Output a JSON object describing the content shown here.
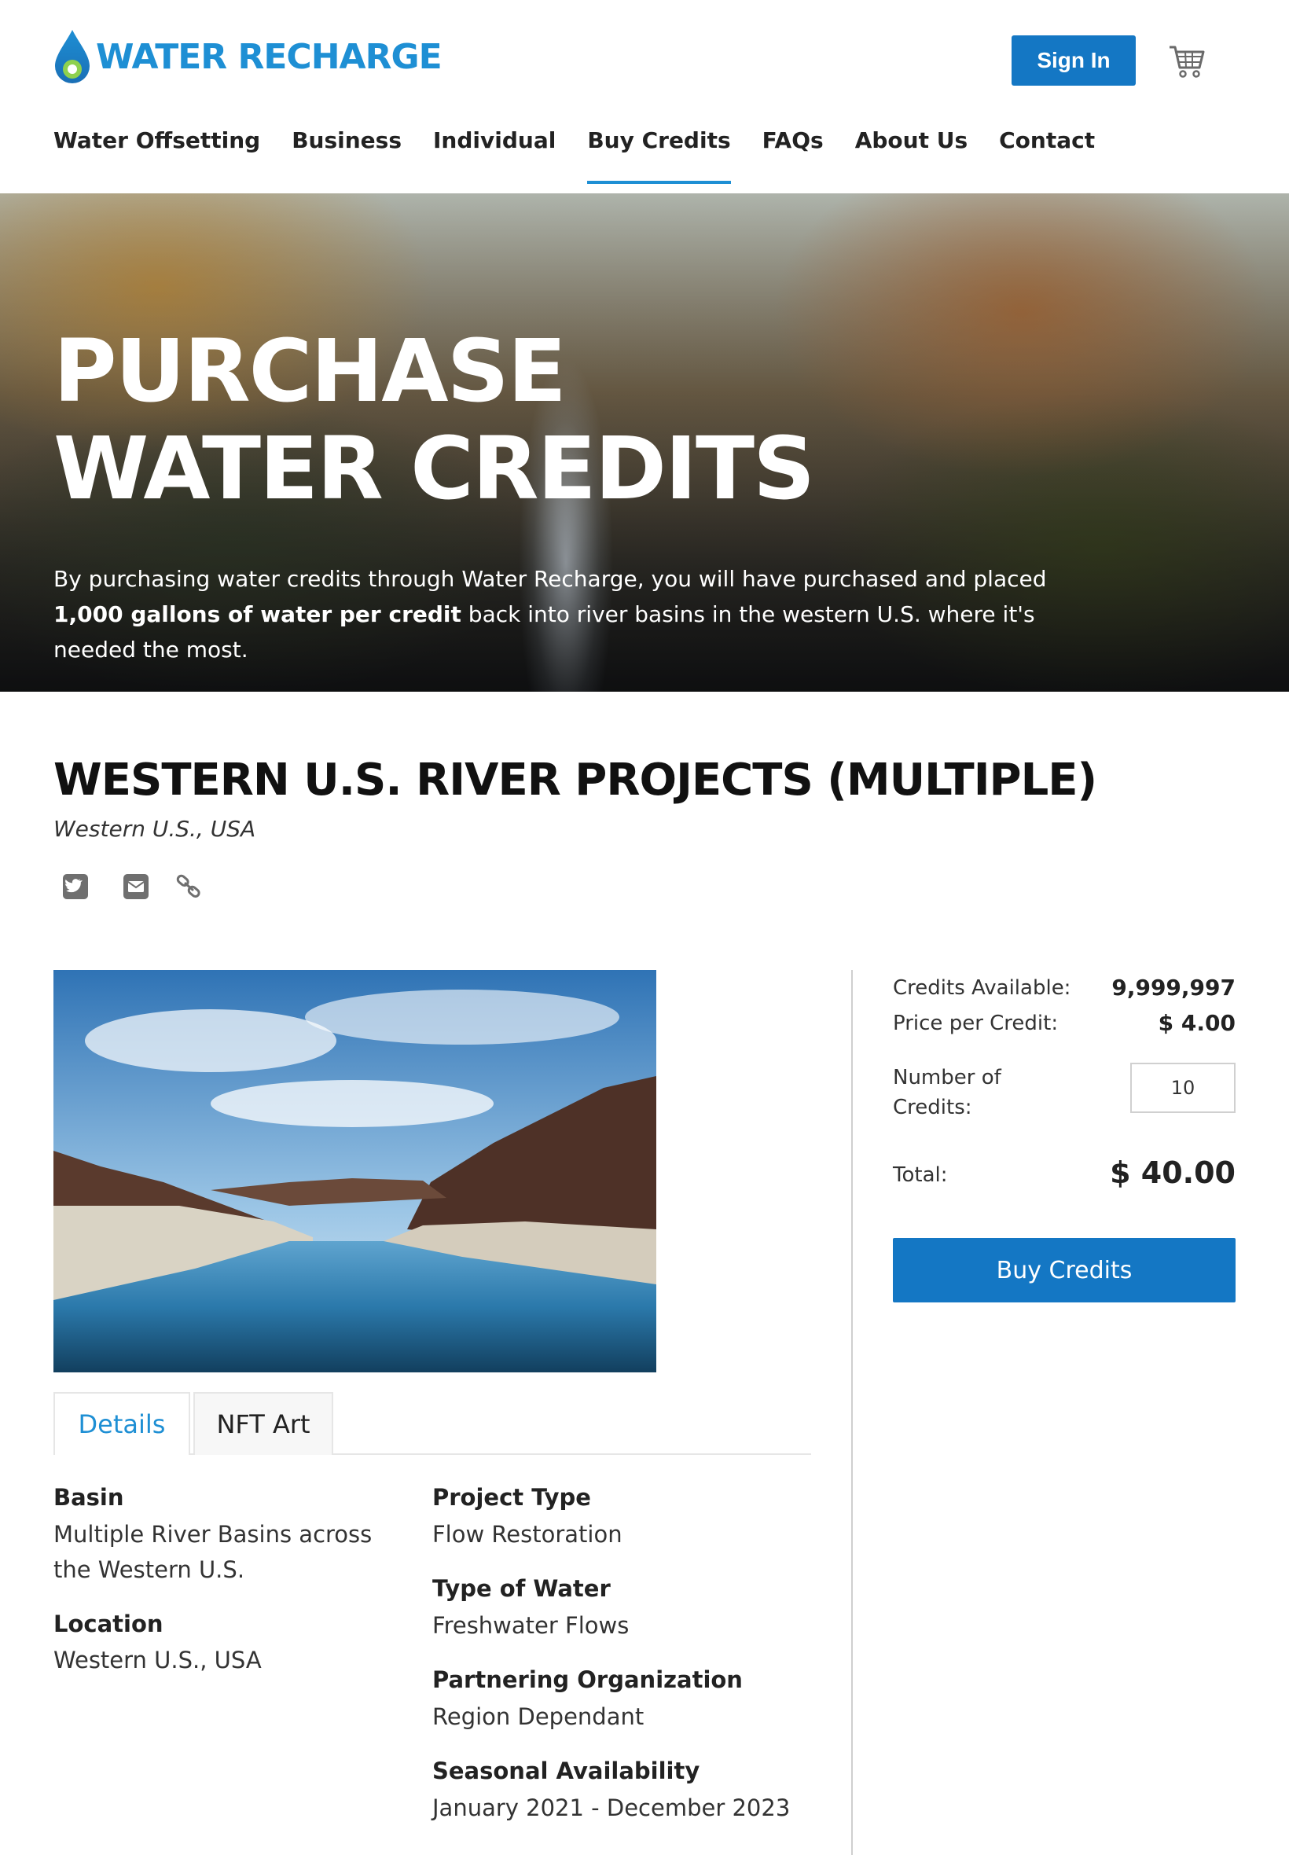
{
  "brand": {
    "name": "WATER RECHARGE"
  },
  "header": {
    "sign_in_label": "Sign In",
    "cart_icon": "cart-icon"
  },
  "nav": {
    "items": [
      {
        "label": "Water Offsetting"
      },
      {
        "label": "Business"
      },
      {
        "label": "Individual"
      },
      {
        "label": "Buy Credits",
        "active": true
      },
      {
        "label": "FAQs"
      },
      {
        "label": "About Us"
      },
      {
        "label": "Contact"
      }
    ]
  },
  "hero": {
    "title": "PURCHASE WATER CREDITS",
    "text_before": "By purchasing water credits through Water Recharge, you will have purchased and placed ",
    "text_bold": "1,000 gallons of water per credit",
    "text_after": " back into river basins in the western U.S. where it's needed the most."
  },
  "project": {
    "title": "WESTERN U.S. RIVER PROJECTS (MULTIPLE)",
    "subtitle": "Western U.S., USA",
    "share_icons": [
      "twitter-icon",
      "email-icon",
      "link-icon"
    ]
  },
  "tabs": [
    {
      "label": "Details",
      "active": true
    },
    {
      "label": "NFT Art",
      "active": false
    }
  ],
  "details": {
    "basin_label": "Basin",
    "basin_value": "Multiple River Basins across the Western U.S.",
    "location_label": "Location",
    "location_value": "Western U.S., USA",
    "project_type_label": "Project Type",
    "project_type_value": "Flow Restoration",
    "water_type_label": "Type of Water",
    "water_type_value": "Freshwater Flows",
    "partner_label": "Partnering Organization",
    "partner_value": "Region Dependant",
    "season_label": "Seasonal Availability",
    "season_value": "January 2021 - December 2023"
  },
  "purchase": {
    "credits_available_label": "Credits Available:",
    "credits_available_value": "9,999,997",
    "price_label": "Price per Credit:",
    "price_value": "$ 4.00",
    "number_label": "Number of Credits:",
    "number_value": "10",
    "total_label": "Total:",
    "total_value": "$ 40.00",
    "buy_label": "Buy Credits"
  },
  "colors": {
    "accent": "#1e8fd4",
    "button": "#1477c4"
  }
}
